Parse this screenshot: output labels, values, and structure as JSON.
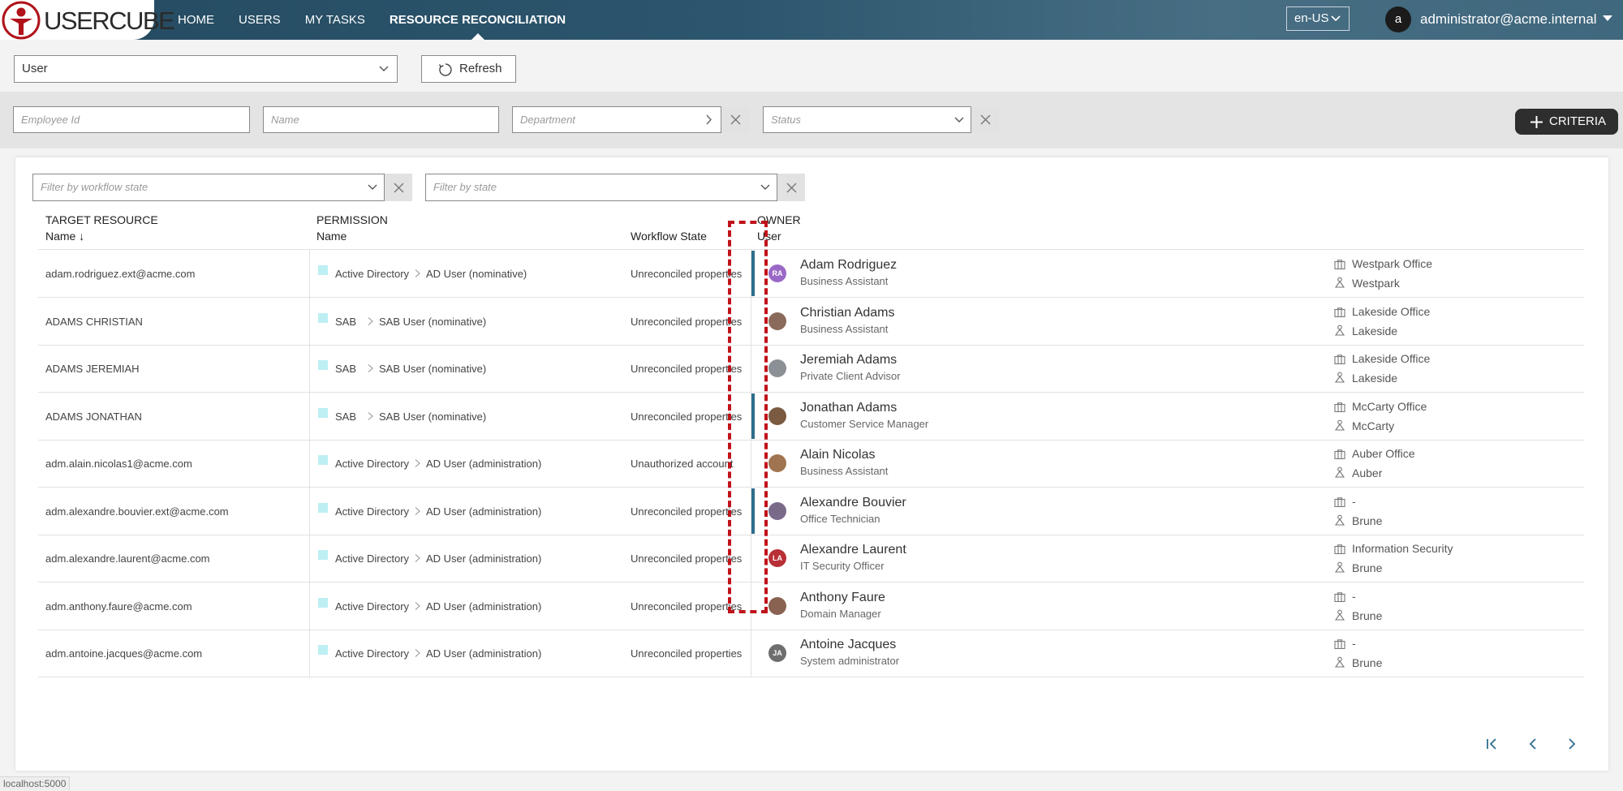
{
  "app": {
    "logo_text": "USERCUBE",
    "nav": [
      "HOME",
      "USERS",
      "MY TASKS",
      "RESOURCE RECONCILIATION"
    ],
    "active_nav": "RESOURCE RECONCILIATION",
    "language": "en-US",
    "user_initial": "a",
    "user_name": "administrator@acme.internal"
  },
  "controls": {
    "entity_select": "User",
    "refresh_label": "Refresh"
  },
  "search": {
    "employee_id_placeholder": "Employee Id",
    "name_placeholder": "Name",
    "department_placeholder": "Department",
    "status_placeholder": "Status",
    "criteria_label": "CRITERIA"
  },
  "filters": {
    "workflow_state_placeholder": "Filter by workflow state",
    "state_placeholder": "Filter by state"
  },
  "table": {
    "headers": {
      "target_group": "TARGET RESOURCE",
      "target_name": "Name",
      "sort_arrow": "↓",
      "permission_group": "PERMISSION",
      "permission_name": "Name",
      "workflow_state": "Workflow State",
      "owner_group": "OWNER",
      "owner_user": "User"
    },
    "rows": [
      {
        "target": "adam.rodriguez.ext@acme.com",
        "perm_system": "Active Directory",
        "perm_name": "AD User (nominative)",
        "workflow": "Unreconciled properties",
        "owner": "Adam Rodriguez",
        "title": "Business Assistant",
        "initials": "RA",
        "avatar_color": "#9a68c6",
        "office": "Westpark Office",
        "site": "Westpark",
        "bar": true
      },
      {
        "target": "ADAMS CHRISTIAN",
        "perm_system": "SAB",
        "perm_name": "SAB User (nominative)",
        "workflow": "Unreconciled properties",
        "owner": "Christian Adams",
        "title": "Business Assistant",
        "initials": "",
        "avatar_color": "#8a6a5a",
        "office": "Lakeside Office",
        "site": "Lakeside",
        "bar": false
      },
      {
        "target": "ADAMS JEREMIAH",
        "perm_system": "SAB",
        "perm_name": "SAB User (nominative)",
        "workflow": "Unreconciled properties",
        "owner": "Jeremiah Adams",
        "title": "Private Client Advisor",
        "initials": "",
        "avatar_color": "#8b8f96",
        "office": "Lakeside Office",
        "site": "Lakeside",
        "bar": false
      },
      {
        "target": "ADAMS JONATHAN",
        "perm_system": "SAB",
        "perm_name": "SAB User (nominative)",
        "workflow": "Unreconciled properties",
        "owner": "Jonathan Adams",
        "title": "Customer Service Manager",
        "initials": "",
        "avatar_color": "#7a5a40",
        "office": "McCarty Office",
        "site": "McCarty",
        "bar": true
      },
      {
        "target": "adm.alain.nicolas1@acme.com",
        "perm_system": "Active Directory",
        "perm_name": "AD User (administration)",
        "workflow": "Unauthorized account",
        "owner": "Alain Nicolas",
        "title": "Business Assistant",
        "initials": "",
        "avatar_color": "#a07450",
        "office": "Auber Office",
        "site": "Auber",
        "bar": false
      },
      {
        "target": "adm.alexandre.bouvier.ext@acme.com",
        "perm_system": "Active Directory",
        "perm_name": "AD User (administration)",
        "workflow": "Unreconciled properties",
        "owner": "Alexandre Bouvier",
        "title": "Office Technician",
        "initials": "",
        "avatar_color": "#7a6a8a",
        "office": "-",
        "site": "Brune",
        "bar": true
      },
      {
        "target": "adm.alexandre.laurent@acme.com",
        "perm_system": "Active Directory",
        "perm_name": "AD User (administration)",
        "workflow": "Unreconciled properties",
        "owner": "Alexandre Laurent",
        "title": "IT Security Officer",
        "initials": "LA",
        "avatar_color": "#b92f36",
        "office": "Information Security",
        "site": "Brune",
        "bar": false
      },
      {
        "target": "adm.anthony.faure@acme.com",
        "perm_system": "Active Directory",
        "perm_name": "AD User (administration)",
        "workflow": "Unreconciled properties",
        "owner": "Anthony Faure",
        "title": "Domain Manager",
        "initials": "",
        "avatar_color": "#8a6252",
        "office": "-",
        "site": "Brune",
        "bar": false
      },
      {
        "target": "adm.antoine.jacques@acme.com",
        "perm_system": "Active Directory",
        "perm_name": "AD User (administration)",
        "workflow": "Unreconciled properties",
        "owner": "Antoine Jacques",
        "title": "System administrator",
        "initials": "JA",
        "avatar_color": "#6e6e6e",
        "office": "-",
        "site": "Brune",
        "bar": false
      }
    ]
  },
  "status_url": "localhost:5000",
  "colors": {
    "topbar": "#2c566e",
    "accent_bar": "#2e6e8e",
    "annotation": "#c0121a",
    "permission_square": "#bdeff3"
  }
}
